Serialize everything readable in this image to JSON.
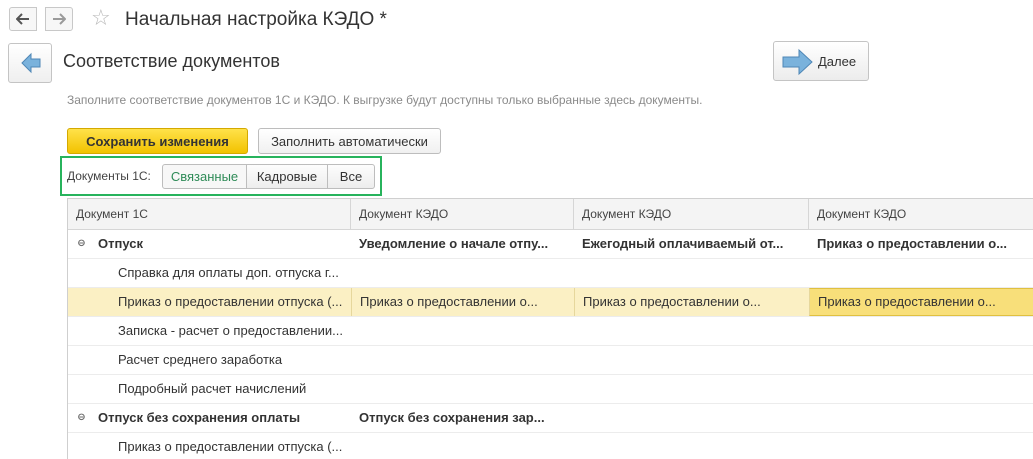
{
  "window": {
    "back_icon": "arrow-left-icon",
    "forward_icon": "arrow-right-icon",
    "favorite_icon": "star-icon",
    "title": "Начальная настройка КЭДО *"
  },
  "step": {
    "title": "Соответствие документов",
    "next_label": "Далее",
    "hint": "Заполните соответствие документов 1С и КЭДО. К выгрузке будут доступны только выбранные здесь документы."
  },
  "actions": {
    "save_label": "Сохранить изменения",
    "autofill_label": "Заполнить автоматически"
  },
  "filter": {
    "label": "Документы 1С:",
    "options": [
      "Связанные",
      "Кадровые",
      "Все"
    ],
    "selected": "Связанные"
  },
  "table": {
    "headers": [
      "Документ 1С",
      "Документ КЭДО",
      "Документ КЭДО",
      "Документ КЭДО"
    ],
    "rows": [
      {
        "group": true,
        "cells": [
          "Отпуск",
          "Уведомление о начале отпу...",
          "Ежегодный оплачиваемый от...",
          "Приказ о предоставлении о..."
        ]
      },
      {
        "group": false,
        "cells": [
          "Справка для оплаты доп. отпуска г...",
          "",
          "",
          ""
        ]
      },
      {
        "group": false,
        "selected": true,
        "cells": [
          "Приказ о предоставлении отпуска (...",
          "Приказ о предоставлении о...",
          "Приказ о предоставлении о...",
          "Приказ о предоставлении о..."
        ]
      },
      {
        "group": false,
        "cells": [
          "Записка - расчет о предоставлении...",
          "",
          "",
          ""
        ]
      },
      {
        "group": false,
        "cells": [
          "Расчет среднего заработка",
          "",
          "",
          ""
        ]
      },
      {
        "group": false,
        "cells": [
          "Подробный расчет начислений",
          "",
          "",
          ""
        ]
      },
      {
        "group": true,
        "cells": [
          "Отпуск без сохранения оплаты",
          "Отпуск без сохранения зар...",
          "",
          ""
        ]
      },
      {
        "group": false,
        "cells": [
          "Приказ о предоставлении отпуска (...",
          "",
          "",
          ""
        ]
      }
    ]
  },
  "colors": {
    "accent_yellow": "#f5c800",
    "highlight_green": "#27b35c",
    "selected_row": "#fbf0c4",
    "active_cell": "#f8df7a"
  }
}
